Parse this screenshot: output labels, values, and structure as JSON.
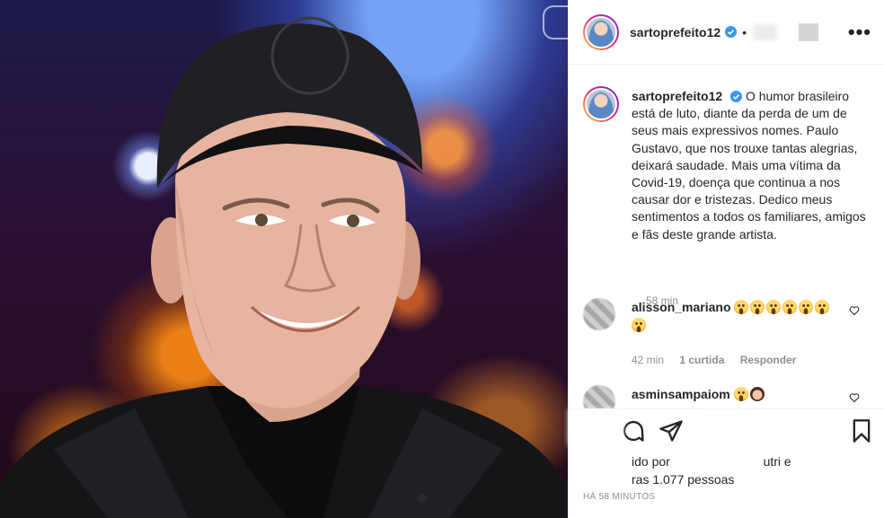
{
  "post": {
    "username": "sartoprefeito12",
    "separator": "•",
    "more_label": "•••"
  },
  "caption": {
    "username": "sartoprefeito12",
    "text": "O humor brasileiro está de luto, diante da perda de um de seus mais expressivos nomes. Paulo Gustavo, que nos trouxe tantas alegrias, deixará saudade. Mais uma vítima da Covid-19, doença que continua a nos causar dor e tristezas. Dedico meus sentimentos a todos os familiares, amigos e fãs deste grande artista.",
    "time": "58 min"
  },
  "comments": [
    {
      "username": "alisson_mariano",
      "emoji_count": 7,
      "time": "42 min",
      "likes": "1 curtida",
      "reply_label": "Responder"
    },
    {
      "username": "asminsampaiom",
      "emoji_count": 2
    }
  ],
  "actions": {
    "liked_by_line1": "ido por",
    "liked_by_line1b": "utri e",
    "liked_by_line2": "ras 1.077 pessoas",
    "posted_ago": "HÁ 58 MINUTOS"
  },
  "colors": {
    "verified": "#3897f0",
    "muted": "#8e8e8e",
    "text": "#262626",
    "border": "#efefef"
  },
  "icons": [
    "verified-badge-icon",
    "more-options-icon",
    "heart-icon",
    "comment-icon",
    "share-icon",
    "bookmark-icon"
  ]
}
